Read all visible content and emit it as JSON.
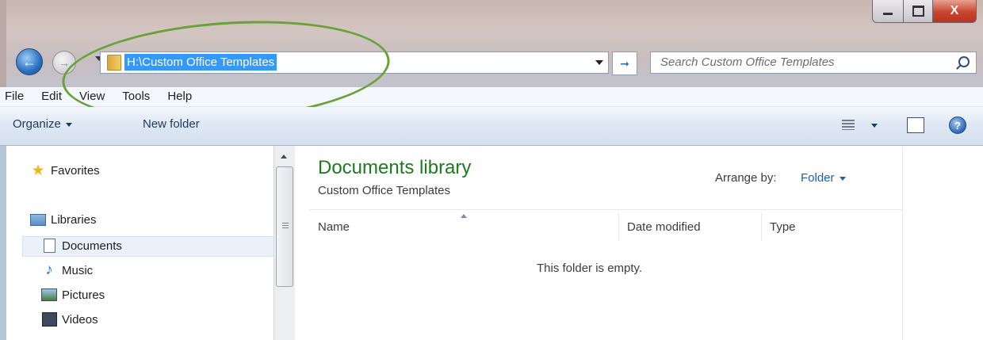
{
  "window": {
    "controls": {
      "minimize_icon": "minimize-icon",
      "maximize_icon": "maximize-icon",
      "close_label": "X"
    }
  },
  "nav": {
    "back_icon": "back-arrow-icon",
    "forward_icon": "forward-arrow-icon",
    "address": "H:\\Custom Office Templates",
    "search_placeholder": "Search Custom Office Templates",
    "refresh_icon": "refresh-icon",
    "search_icon": "search-icon"
  },
  "menu": {
    "items": [
      "File",
      "Edit",
      "View",
      "Tools",
      "Help"
    ]
  },
  "toolbar": {
    "organize": "Organize",
    "new_folder": "New folder",
    "help_label": "?"
  },
  "sidebar": {
    "favorites": "Favorites",
    "libraries": "Libraries",
    "items": [
      "Documents",
      "Music",
      "Pictures",
      "Videos"
    ],
    "selected": "Documents"
  },
  "content": {
    "title": "Documents library",
    "subtitle": "Custom Office Templates",
    "arrange_label": "Arrange by:",
    "arrange_value": "Folder",
    "columns": [
      "Name",
      "Date modified",
      "Type"
    ],
    "empty_message": "This folder is empty."
  },
  "annotation": {
    "color": "#6aa23a"
  }
}
